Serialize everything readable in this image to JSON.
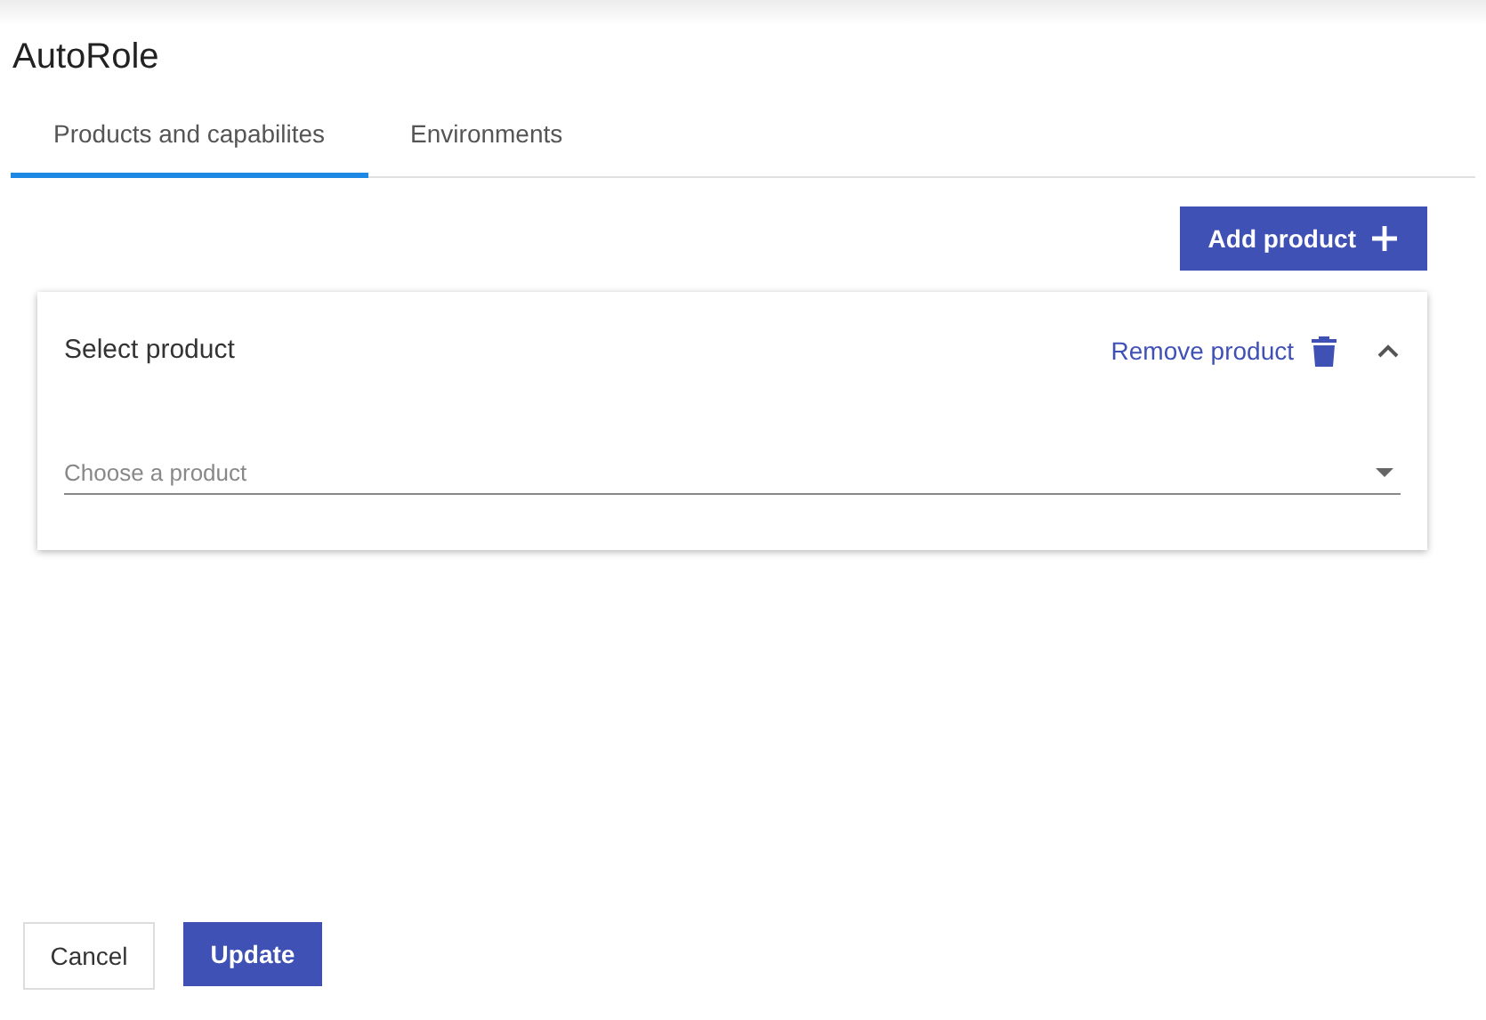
{
  "title": "AutoRole",
  "tabs": [
    {
      "label": "Products and capabilites",
      "selected": true
    },
    {
      "label": "Environments",
      "selected": false
    }
  ],
  "add_button": "Add product",
  "products": [
    {
      "title": "Select product",
      "remove_label": "Remove product",
      "expanded": true,
      "select": {
        "placeholder": "Choose a product"
      }
    }
  ],
  "buttons": {
    "cancel": "Cancel",
    "update": "Update"
  }
}
